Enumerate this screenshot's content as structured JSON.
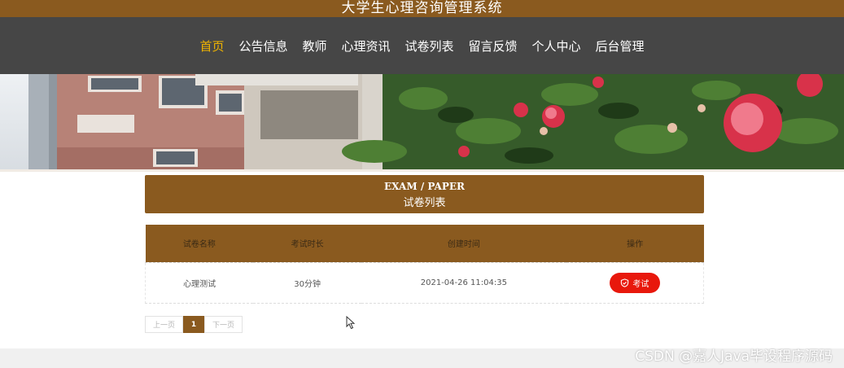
{
  "header": {
    "title": "大学生心理咨询管理系统"
  },
  "nav": {
    "items": [
      {
        "label": "首页",
        "active": true
      },
      {
        "label": "公告信息",
        "active": false
      },
      {
        "label": "教师",
        "active": false
      },
      {
        "label": "心理资讯",
        "active": false
      },
      {
        "label": "试卷列表",
        "active": false
      },
      {
        "label": "留言反馈",
        "active": false
      },
      {
        "label": "个人中心",
        "active": false
      },
      {
        "label": "后台管理",
        "active": false
      }
    ]
  },
  "section": {
    "title_en": "EXAM / PAPER",
    "title_cn": "试卷列表"
  },
  "table": {
    "headers": [
      "试卷名称",
      "考试时长",
      "创建时间",
      "操作"
    ],
    "rows": [
      {
        "name": "心理测试",
        "duration": "30分钟",
        "created": "2021-04-26 11:04:35",
        "action": "考试"
      }
    ]
  },
  "pager": {
    "prev": "上一页",
    "current": "1",
    "next": "下一页"
  },
  "watermark": "CSDN @嘉人Java毕设程序源码",
  "colors": {
    "brand": "#8a5a1f",
    "nav_bg": "#464646",
    "active_nav": "#f0b400",
    "exam_button": "#e8180c"
  },
  "icons": {
    "exam_button_icon": "shield-check-icon",
    "cursor": "mouse-pointer-icon"
  }
}
